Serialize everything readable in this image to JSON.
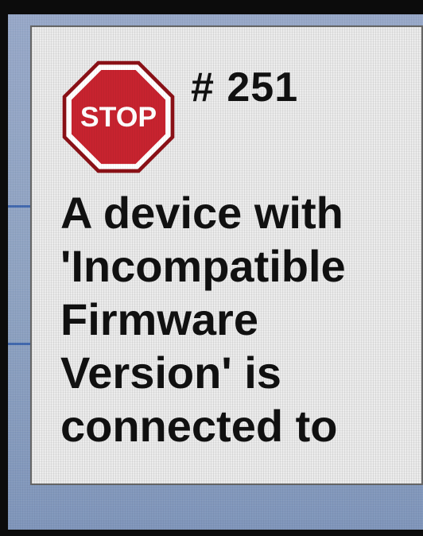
{
  "colors": {
    "dialog_background": "#ececec",
    "stop_sign_red": "#c7232f",
    "stop_sign_border": "#ffffff",
    "screen_background": "#8fa3c2",
    "accent_line": "#2a57a8"
  },
  "dialog": {
    "icon": "stop-sign-icon",
    "stop_text": "STOP",
    "error_code": "# 251",
    "message_lines": [
      "A device with",
      "'Incompatible",
      "Firmware",
      "Version' is",
      "connected to"
    ]
  }
}
